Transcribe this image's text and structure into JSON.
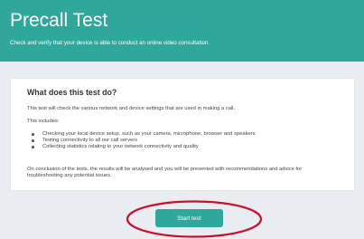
{
  "header": {
    "title": "Precall Test",
    "subtitle": "Check and verify that your device is able to conduct an online video consultation."
  },
  "card": {
    "title": "What does this test do?",
    "intro": "This test will check the various network and device settings that are used in making a call.",
    "includes_label": "This includes:",
    "bullets": [
      "Checking your local device setup, such as your camera, microphone, browser and speakers",
      "Testing connectivity to all our call servers",
      "Collecting statistics relating to your network connectivity and quality"
    ],
    "conclusion": "On conclusion of the tests, the results will be analysed and you will be presented with recommendations and advice for troubleshooting any potential issues."
  },
  "actions": {
    "start_label": "Start test"
  },
  "colors": {
    "brand": "#2fa79a",
    "page_background": "#e9edf2",
    "highlight_ring": "#c8102e"
  }
}
